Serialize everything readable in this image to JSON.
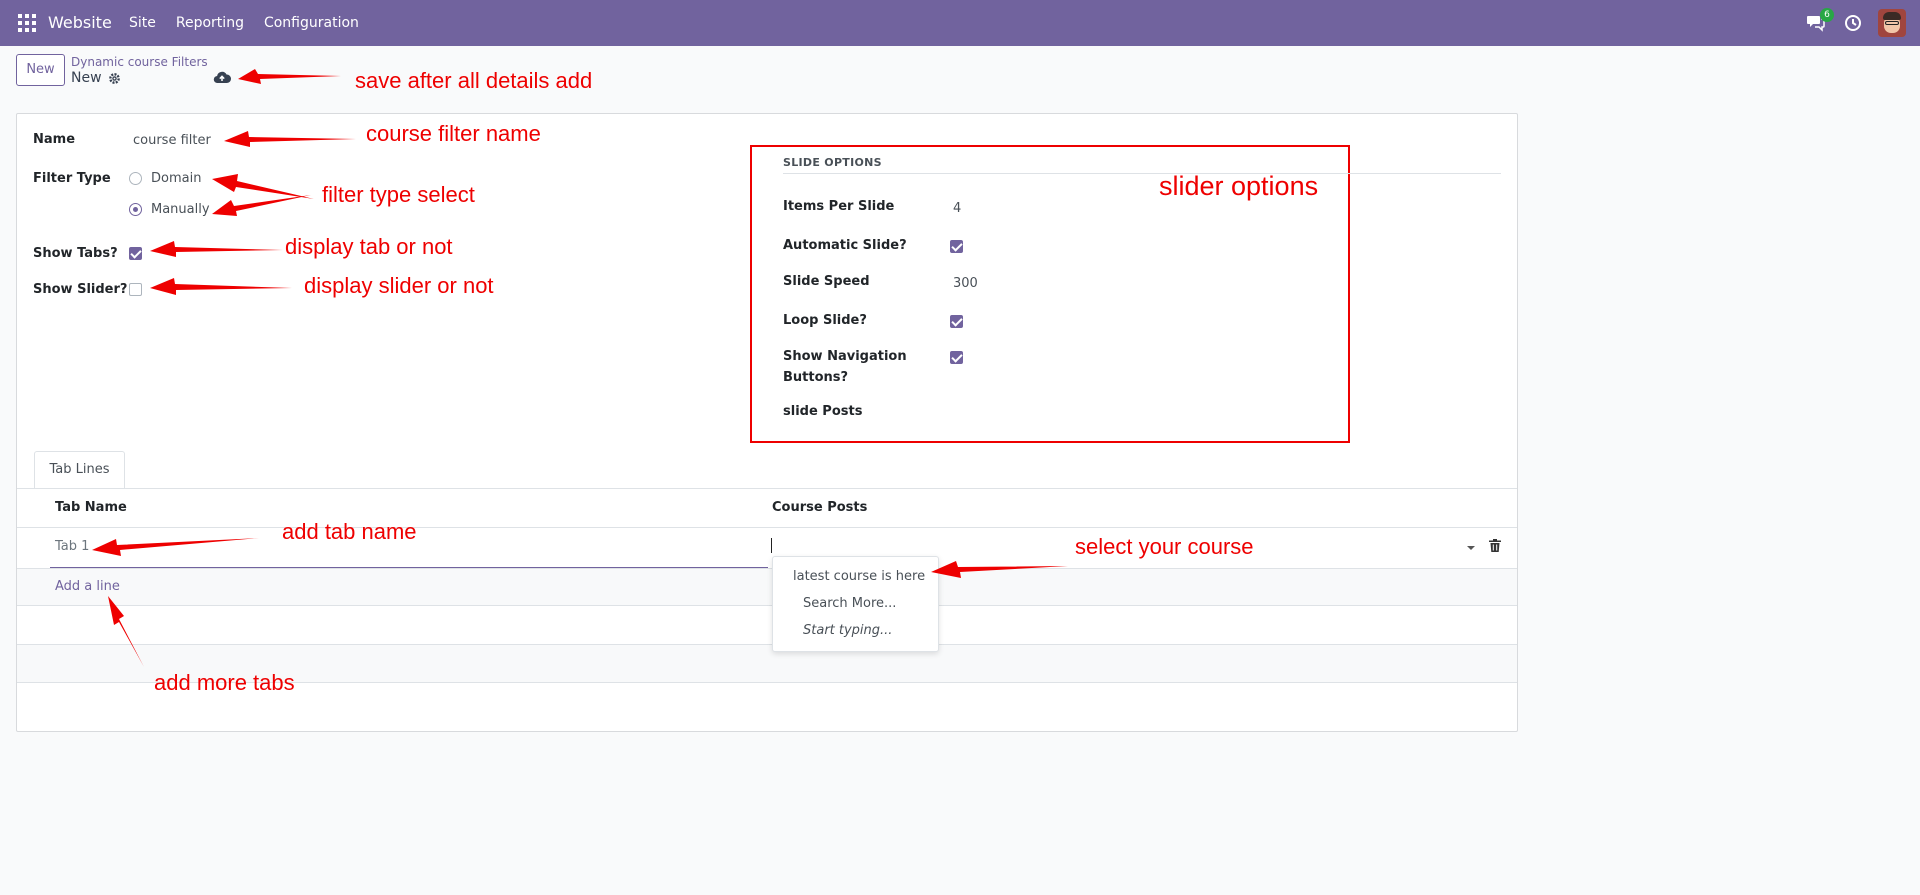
{
  "navbar": {
    "brand": "Website",
    "menu": [
      "Site",
      "Reporting",
      "Configuration"
    ],
    "chat_badge": "6",
    "bg_color": "#71639e"
  },
  "control_panel": {
    "new_label": "New",
    "breadcrumb": "Dynamic course Filters",
    "record_name": "New"
  },
  "form": {
    "name_label": "Name",
    "name_value": "course filter",
    "filter_type_label": "Filter Type",
    "filter_type_options": [
      {
        "label": "Domain",
        "selected": false
      },
      {
        "label": "Manually",
        "selected": true
      }
    ],
    "show_tabs_label": "Show Tabs?",
    "show_tabs_checked": true,
    "show_slider_label": "Show Slider?",
    "show_slider_checked": false
  },
  "slide_options": {
    "title": "SLIDE OPTIONS",
    "items_per_slide_label": "Items Per Slide",
    "items_per_slide_value": "4",
    "automatic_slide_label": "Automatic Slide?",
    "automatic_slide_checked": true,
    "slide_speed_label": "Slide Speed",
    "slide_speed_value": "300",
    "loop_slide_label": "Loop Slide?",
    "loop_slide_checked": true,
    "show_nav_label_line1": "Show Navigation",
    "show_nav_label_line2": "Buttons?",
    "show_nav_checked": true,
    "slide_posts_label": "slide Posts"
  },
  "notebook": {
    "tab_label": "Tab Lines",
    "columns": [
      "Tab Name",
      "Course Posts"
    ],
    "rows": [
      {
        "tab_name": "Tab 1"
      }
    ],
    "add_line": "Add a line"
  },
  "dropdown": {
    "items": [
      "latest course is here",
      "Search More...",
      "Start typing..."
    ]
  },
  "annotations": {
    "save": "save after all details add",
    "name": "course filter name",
    "filter_type": "filter type select",
    "tabs": "display tab or not",
    "slider": "display slider or not",
    "slider_options": "slider options",
    "tab_name": "add tab name",
    "course": "select your course",
    "more_tabs": "add more tabs"
  },
  "colors": {
    "accent": "#71639e",
    "annotation": "#ee0000"
  }
}
